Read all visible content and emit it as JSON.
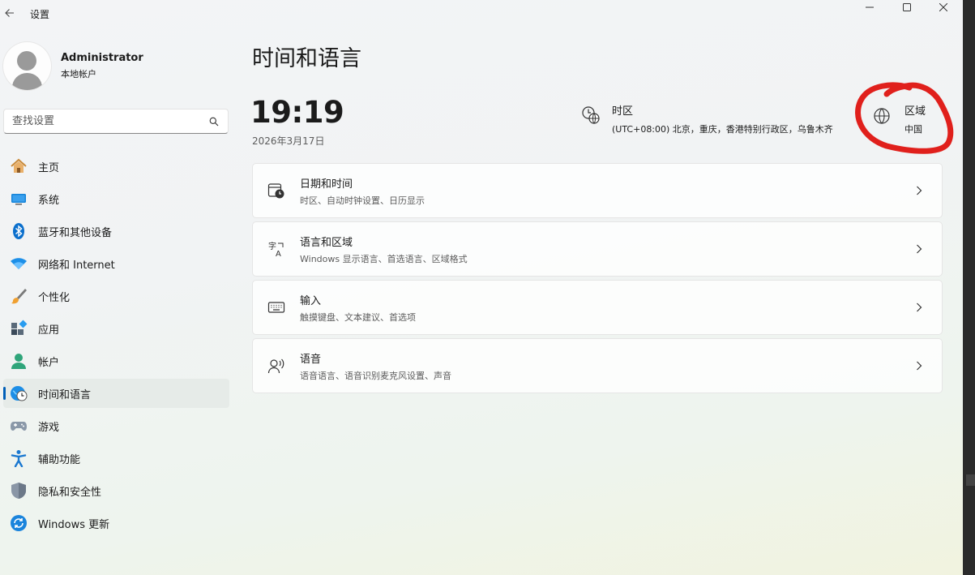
{
  "window": {
    "title": "设置"
  },
  "profile": {
    "name": "Administrator",
    "account_type": "本地帐户"
  },
  "search": {
    "placeholder": "查找设置"
  },
  "sidebar": {
    "items": [
      {
        "label": "主页",
        "icon": "home-icon"
      },
      {
        "label": "系统",
        "icon": "system-icon"
      },
      {
        "label": "蓝牙和其他设备",
        "icon": "bluetooth-icon"
      },
      {
        "label": "网络和 Internet",
        "icon": "wifi-icon"
      },
      {
        "label": "个性化",
        "icon": "brush-icon"
      },
      {
        "label": "应用",
        "icon": "apps-icon"
      },
      {
        "label": "帐户",
        "icon": "account-icon"
      },
      {
        "label": "时间和语言",
        "icon": "time-language-icon",
        "active": true
      },
      {
        "label": "游戏",
        "icon": "gamepad-icon"
      },
      {
        "label": "辅助功能",
        "icon": "accessibility-icon"
      },
      {
        "label": "隐私和安全性",
        "icon": "shield-icon"
      },
      {
        "label": "Windows 更新",
        "icon": "update-icon"
      }
    ]
  },
  "main": {
    "title": "时间和语言",
    "time": "19:19",
    "date": "2026年3月17日",
    "timezone": {
      "label": "时区",
      "value": "(UTC+08:00) 北京，重庆，香港特别行政区，乌鲁木齐"
    },
    "region": {
      "label": "区域",
      "value": "中国"
    },
    "cards": [
      {
        "title": "日期和时间",
        "subtitle": "时区、自动时钟设置、日历显示",
        "icon": "calendar-clock-icon"
      },
      {
        "title": "语言和区域",
        "subtitle": "Windows 显示语言、首选语言、区域格式",
        "icon": "language-icon"
      },
      {
        "title": "输入",
        "subtitle": "触摸键盘、文本建议、首选项",
        "icon": "keyboard-icon"
      },
      {
        "title": "语音",
        "subtitle": "语音语言、语音识别麦克风设置、声音",
        "icon": "speech-icon"
      }
    ]
  },
  "colors": {
    "accent": "#005fb8",
    "annotation": "#e0201c"
  }
}
